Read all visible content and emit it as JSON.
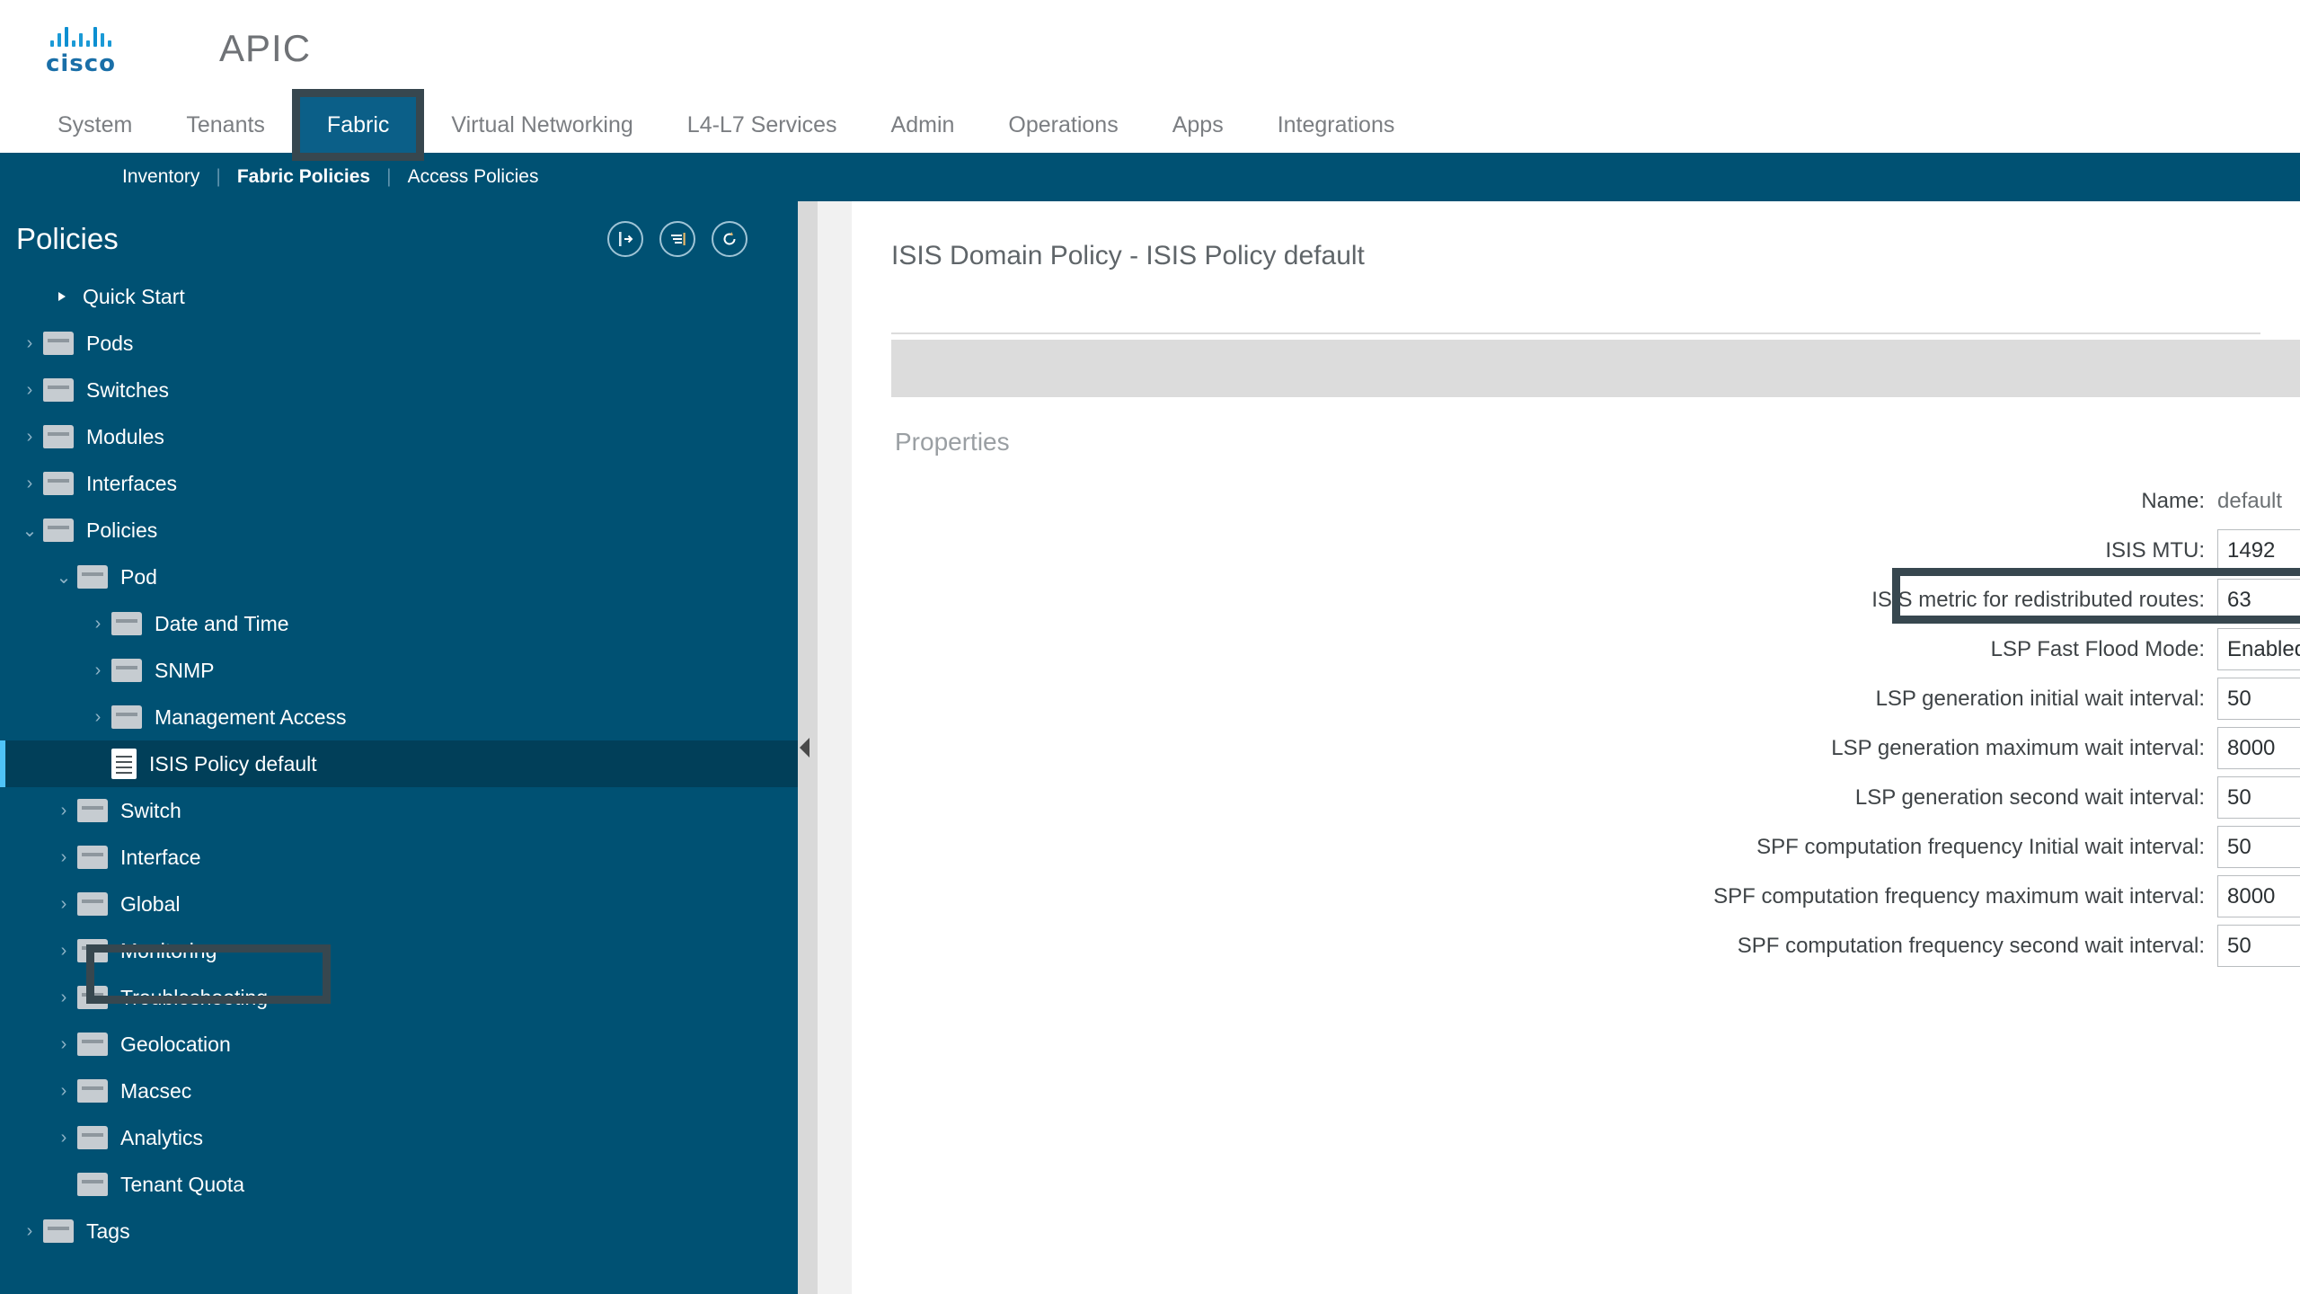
{
  "brand": {
    "vendor": "cisco",
    "product": "APIC",
    "logo_color": "#1a6fa8"
  },
  "mainnav": {
    "active": "Fabric",
    "tabs": [
      {
        "label": "System",
        "active": false
      },
      {
        "label": "Tenants",
        "active": false
      },
      {
        "label": "Fabric",
        "active": true
      },
      {
        "label": "Virtual Networking",
        "active": false
      },
      {
        "label": "L4-L7 Services",
        "active": false
      },
      {
        "label": "Admin",
        "active": false
      },
      {
        "label": "Operations",
        "active": false
      },
      {
        "label": "Apps",
        "active": false
      },
      {
        "label": "Integrations",
        "active": false
      }
    ]
  },
  "subnav": {
    "items": [
      {
        "label": "Inventory",
        "active": false
      },
      {
        "label": "Fabric Policies",
        "active": true
      },
      {
        "label": "Access Policies",
        "active": false
      }
    ],
    "separator": "|"
  },
  "sidebar": {
    "title": "Policies",
    "accent_color": "#005173",
    "selected_color": "#013f59",
    "head_icons": [
      {
        "name": "collapse-panel-icon"
      },
      {
        "name": "filter-list-icon"
      },
      {
        "name": "refresh-icon"
      }
    ],
    "tree": [
      {
        "label": "Quick Start",
        "icon": "quickstart",
        "indent": 0,
        "chevron": "none",
        "selected": false
      },
      {
        "label": "Pods",
        "icon": "folder",
        "indent": 0,
        "chevron": "right",
        "selected": false
      },
      {
        "label": "Switches",
        "icon": "folder",
        "indent": 0,
        "chevron": "right",
        "selected": false
      },
      {
        "label": "Modules",
        "icon": "folder",
        "indent": 0,
        "chevron": "right",
        "selected": false
      },
      {
        "label": "Interfaces",
        "icon": "folder",
        "indent": 0,
        "chevron": "right",
        "selected": false
      },
      {
        "label": "Policies",
        "icon": "folder",
        "indent": 0,
        "chevron": "down",
        "selected": false
      },
      {
        "label": "Pod",
        "icon": "folder",
        "indent": 1,
        "chevron": "down",
        "selected": false
      },
      {
        "label": "Date and Time",
        "icon": "folder",
        "indent": 2,
        "chevron": "right",
        "selected": false
      },
      {
        "label": "SNMP",
        "icon": "folder",
        "indent": 2,
        "chevron": "right",
        "selected": false
      },
      {
        "label": "Management Access",
        "icon": "folder",
        "indent": 2,
        "chevron": "right",
        "selected": false
      },
      {
        "label": "ISIS Policy default",
        "icon": "document",
        "indent": 2,
        "chevron": "none",
        "selected": true
      },
      {
        "label": "Switch",
        "icon": "folder",
        "indent": 1,
        "chevron": "right",
        "selected": false
      },
      {
        "label": "Interface",
        "icon": "folder",
        "indent": 1,
        "chevron": "right",
        "selected": false
      },
      {
        "label": "Global",
        "icon": "folder",
        "indent": 1,
        "chevron": "right",
        "selected": false
      },
      {
        "label": "Monitoring",
        "icon": "folder",
        "indent": 1,
        "chevron": "right",
        "selected": false
      },
      {
        "label": "Troubleshooting",
        "icon": "folder",
        "indent": 1,
        "chevron": "right",
        "selected": false
      },
      {
        "label": "Geolocation",
        "icon": "folder",
        "indent": 1,
        "chevron": "right",
        "selected": false
      },
      {
        "label": "Macsec",
        "icon": "folder",
        "indent": 1,
        "chevron": "right",
        "selected": false
      },
      {
        "label": "Analytics",
        "icon": "folder",
        "indent": 1,
        "chevron": "right",
        "selected": false
      },
      {
        "label": "Tenant Quota",
        "icon": "folder",
        "indent": 1,
        "chevron": "none",
        "selected": false
      },
      {
        "label": "Tags",
        "icon": "folder",
        "indent": 0,
        "chevron": "right",
        "selected": false
      }
    ]
  },
  "content": {
    "title": "ISIS Domain Policy - ISIS Policy default",
    "section_label": "Properties",
    "highlight_color": "#37474f",
    "fields": [
      {
        "label": "Name:",
        "value": "default",
        "control": "static",
        "highlighted": false
      },
      {
        "label": "ISIS MTU:",
        "value": "1492",
        "control": "spinner",
        "highlighted": false
      },
      {
        "label": "ISIS metric for redistributed routes:",
        "value": "63",
        "control": "spinner",
        "highlighted": true
      },
      {
        "label": "LSP Fast Flood Mode:",
        "value": "Enabled",
        "control": "select",
        "highlighted": false
      },
      {
        "label": "LSP generation initial wait interval:",
        "value": "50",
        "control": "spinner",
        "highlighted": false
      },
      {
        "label": "LSP generation maximum wait interval:",
        "value": "8000",
        "control": "spinner",
        "highlighted": false
      },
      {
        "label": "LSP generation second wait interval:",
        "value": "50",
        "control": "spinner",
        "highlighted": false
      },
      {
        "label": "SPF computation frequency Initial wait interval:",
        "value": "50",
        "control": "spinner",
        "highlighted": false
      },
      {
        "label": "SPF computation frequency maximum wait interval:",
        "value": "8000",
        "control": "spinner",
        "highlighted": false
      },
      {
        "label": "SPF computation frequency second wait interval:",
        "value": "50",
        "control": "spinner",
        "highlighted": false
      }
    ]
  }
}
